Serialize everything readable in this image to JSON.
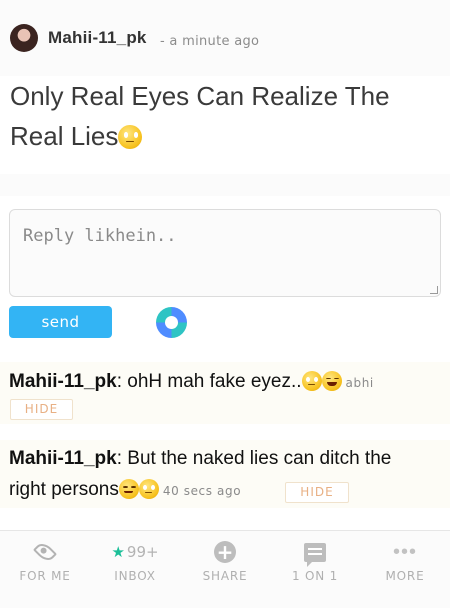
{
  "post": {
    "author": "Mahii-11_pk",
    "time": "- a minute ago",
    "title": "Only Real Eyes Can Realize The Real Lies"
  },
  "reply": {
    "placeholder": "Reply likhein..",
    "send_label": "send"
  },
  "comments": [
    {
      "author": "Mahii-11_pk",
      "text": ": ohH mah fake eyez..",
      "meta": "abhi",
      "hide_label": "HIDE"
    },
    {
      "author": "Mahii-11_pk",
      "text": ": But the naked lies can ditch the right persons",
      "meta": "40 secs ago",
      "hide_label": "HIDE"
    }
  ],
  "nav": {
    "items": [
      {
        "label": "FOR ME",
        "icon": "eye-icon"
      },
      {
        "label": "INBOX",
        "icon": "star-icon",
        "count": "99+"
      },
      {
        "label": "SHARE",
        "icon": "plus-icon"
      },
      {
        "label": "1 ON 1",
        "icon": "chat-icon"
      },
      {
        "label": "MORE",
        "icon": "more-icon"
      }
    ]
  },
  "colors": {
    "accent": "#33b4f4",
    "hide_text": "#e8b084",
    "star": "#1bbf98",
    "comment_bg": "#fdfcf6"
  }
}
